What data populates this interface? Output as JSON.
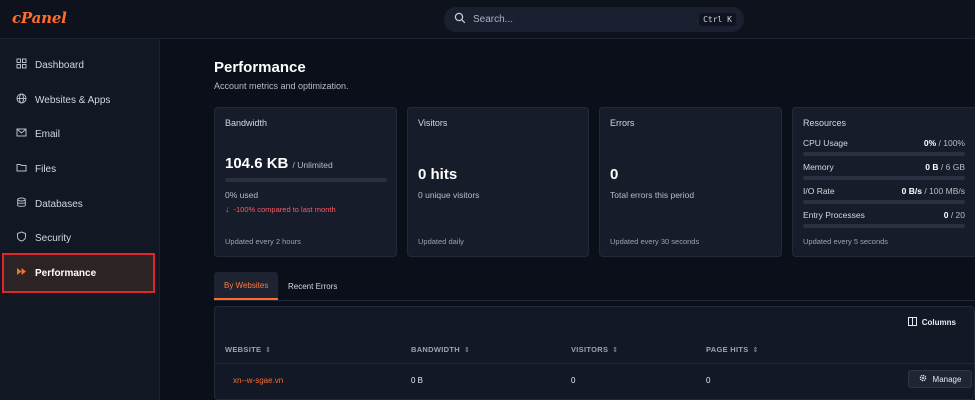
{
  "app": {
    "logo": "cPanel"
  },
  "search": {
    "placeholder": "Search...",
    "shortcut": "Ctrl K"
  },
  "sidebar": {
    "items": [
      {
        "label": "Dashboard",
        "icon": "grid-icon"
      },
      {
        "label": "Websites & Apps",
        "icon": "globe-icon"
      },
      {
        "label": "Email",
        "icon": "mail-icon"
      },
      {
        "label": "Files",
        "icon": "folder-icon"
      },
      {
        "label": "Databases",
        "icon": "database-icon"
      },
      {
        "label": "Security",
        "icon": "shield-icon"
      },
      {
        "label": "Performance",
        "icon": "fast-forward-icon",
        "active": true
      }
    ]
  },
  "page": {
    "title": "Performance",
    "subtitle": "Account metrics and optimization."
  },
  "cards": {
    "bandwidth": {
      "title": "Bandwidth",
      "value": "104.6 KB",
      "limit": "/ Unlimited",
      "used": "0% used",
      "used_fraction": 0,
      "change": "-100% compared to last month",
      "footer": "Updated every 2 hours"
    },
    "visitors": {
      "title": "Visitors",
      "value": "0 hits",
      "sub": "0 unique visitors",
      "footer": "Updated daily"
    },
    "errors": {
      "title": "Errors",
      "value": "0",
      "sub": "Total errors this period",
      "footer": "Updated every 30 seconds"
    },
    "resources": {
      "title": "Resources",
      "rows": [
        {
          "label": "CPU Usage",
          "value": "0%",
          "limit": "/ 100%",
          "fraction": 0
        },
        {
          "label": "Memory",
          "value": "0 B",
          "limit": "/ 6 GB",
          "fraction": 0
        },
        {
          "label": "I/O Rate",
          "value": "0 B/s",
          "limit": "/ 100 MB/s",
          "fraction": 0
        },
        {
          "label": "Entry Processes",
          "value": "0",
          "limit": "/ 20",
          "fraction": 0
        }
      ],
      "footer": "Updated every 5 seconds"
    }
  },
  "tabs": [
    {
      "label": "By Websites",
      "active": true
    },
    {
      "label": "Recent Errors",
      "active": false
    }
  ],
  "table": {
    "columns_button": "Columns",
    "headers": [
      "WEBSITE",
      "BANDWIDTH",
      "VISITORS",
      "PAGE HITS"
    ],
    "rows": [
      {
        "website": "xn--w-sgae.vn",
        "bandwidth": "0 B",
        "visitors": "0",
        "page_hits": "0",
        "action": "Manage"
      }
    ]
  },
  "colors": {
    "accent": "#ff6c2c",
    "negative": "#ff5a66",
    "active_border": "#e0252d"
  }
}
